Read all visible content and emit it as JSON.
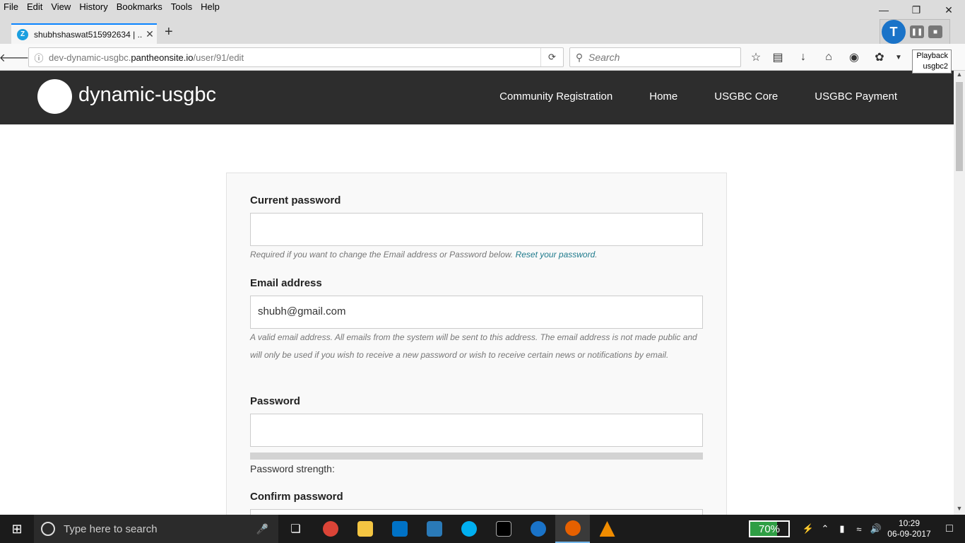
{
  "browser": {
    "menu": [
      "File",
      "Edit",
      "View",
      "History",
      "Bookmarks",
      "Tools",
      "Help"
    ],
    "tab_title": "shubhshaswat515992634 | ...",
    "url_prefix": "dev-dynamic-usgbc.",
    "url_host": "pantheonsite.io",
    "url_path": "/user/91/edit",
    "search_placeholder": "Search",
    "tooltip_line1": "Playback",
    "tooltip_line2": "usgbc2"
  },
  "site": {
    "name": "dynamic-usgbc",
    "nav": [
      "Community Registration",
      "Home",
      "USGBC Core",
      "USGBC Payment"
    ]
  },
  "form": {
    "current_password_label": "Current password",
    "current_password_value": "",
    "current_password_help": "Required if you want to change the Email address or Password below.",
    "reset_link": "Reset your password",
    "email_label": "Email address",
    "email_value": "shubh@gmail.com",
    "email_help": "A valid email address. All emails from the system will be sent to this address. The email address is not made public and will only be used if you wish to receive a new password or wish to receive certain news or notifications by email.",
    "password_label": "Password",
    "password_value": "",
    "strength_label": "Password strength:",
    "confirm_label": "Confirm password"
  },
  "taskbar": {
    "search_placeholder": "Type here to search",
    "battery": "70%",
    "battery_level": 0.7,
    "time": "10:29",
    "date": "06-09-2017"
  }
}
